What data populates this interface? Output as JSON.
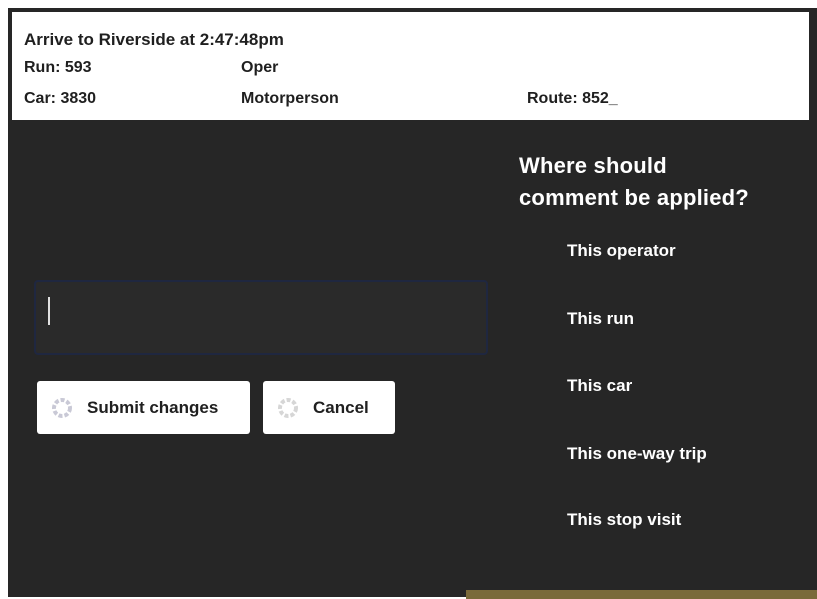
{
  "header": {
    "arrive": "Arrive to Riverside at 2:47:48pm",
    "run": "Run: 593",
    "operator": "Oper",
    "car": "Car: 3830",
    "motorperson": "Motorperson",
    "route": "Route: 852_"
  },
  "question": {
    "line1": "Where should",
    "line2": "comment be applied?"
  },
  "options": [
    "This operator",
    "This run",
    "This car",
    "This one-way trip",
    "This stop visit"
  ],
  "comment": {
    "value": "",
    "placeholder": ""
  },
  "buttons": {
    "submit": "Submit changes",
    "cancel": "Cancel"
  }
}
